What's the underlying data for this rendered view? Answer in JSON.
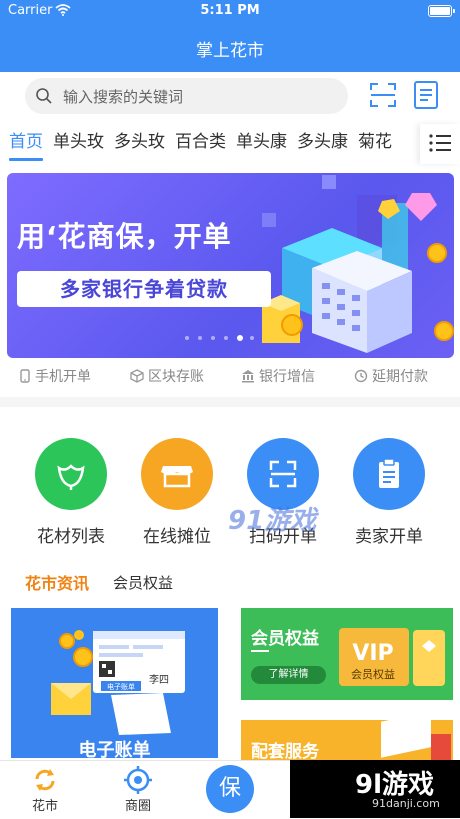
{
  "status": {
    "carrier": "Carrier",
    "time": "5:11 PM"
  },
  "nav": {
    "title": "掌上花市"
  },
  "search": {
    "placeholder": "输入搜索的关键词"
  },
  "tabs": [
    "首页",
    "单头玫",
    "多头玫",
    "百合类",
    "单头康",
    "多头康",
    "菊花"
  ],
  "banner": {
    "line1": "用‘花商保，开单",
    "line2": "多家银行争着贷款",
    "dots": 6,
    "active_dot": 4
  },
  "features": [
    "手机开单",
    "区块存账",
    "银行增信",
    "延期付款"
  ],
  "grid": [
    {
      "label": "花材列表",
      "icon": "flower-icon",
      "color": "#2cc55a"
    },
    {
      "label": "在线摊位",
      "icon": "stall-icon",
      "color": "#f6a623"
    },
    {
      "label": "扫码开单",
      "icon": "scan-icon",
      "color": "#3a8ef5"
    },
    {
      "label": "卖家开单",
      "icon": "clipboard-icon",
      "color": "#3a8ef5"
    }
  ],
  "section": {
    "news": "花市资讯",
    "member": "会员权益"
  },
  "cards": {
    "bill": {
      "title": "电子账单",
      "pill": "电子账单",
      "cert": "李四"
    },
    "vip": {
      "title": "会员权益",
      "button": "了解详情",
      "badge_en": "VIP",
      "badge_cn": "会员权益"
    },
    "service": {
      "title": "配套服务"
    }
  },
  "tabbar": {
    "items": [
      "花市",
      "商圈",
      "保"
    ]
  },
  "watermark": {
    "center": "91游戏",
    "corner_big": "9l游戏",
    "corner_small": "91danji.com"
  },
  "colors": {
    "primary": "#3a8ef5",
    "orange": "#f08313",
    "green": "#2cc55a",
    "yellow": "#f6a623"
  }
}
